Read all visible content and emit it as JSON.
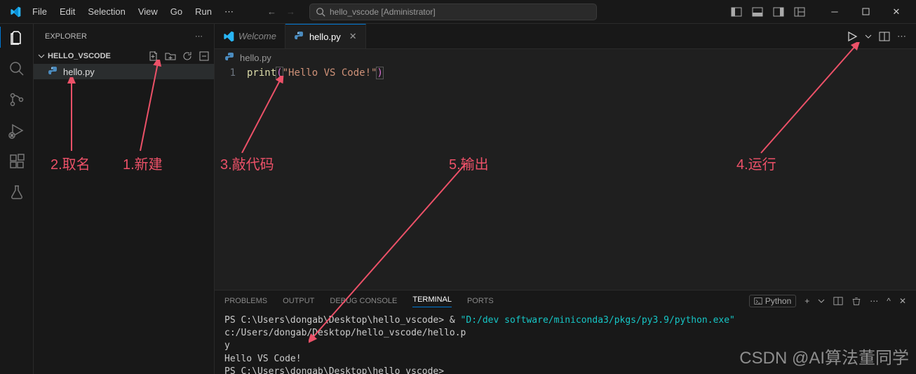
{
  "menu": [
    "File",
    "Edit",
    "Selection",
    "View",
    "Go",
    "Run"
  ],
  "search_placeholder": "hello_vscode [Administrator]",
  "sidebar": {
    "title": "EXPLORER",
    "folder": "HELLO_VSCODE",
    "file": "hello.py"
  },
  "tabs": {
    "welcome": "Welcome",
    "file": "hello.py"
  },
  "breadcrumb": "hello.py",
  "code": {
    "line_no": "1",
    "fn": "print",
    "lb": "(",
    "str": "\"Hello VS Code!\"",
    "rb": ")"
  },
  "panel": {
    "tabs": {
      "problems": "PROBLEMS",
      "output": "OUTPUT",
      "debug": "DEBUG CONSOLE",
      "terminal": "TERMINAL",
      "ports": "PORTS"
    },
    "shell": "Python"
  },
  "terminal": {
    "line1_prefix": "PS C:\\Users\\dongab\\Desktop\\hello_vscode> & ",
    "line1_cmd": "\"D:/dev software/miniconda3/pkgs/py3.9/python.exe\"",
    "line1_suffix": " c:/Users/dongab/Desktop/hello_vscode/hello.p",
    "line2": "y",
    "line3": "Hello VS Code!",
    "line4": "PS C:\\Users\\dongab\\Desktop\\hello_vscode>"
  },
  "annotations": {
    "a1": "1.新建",
    "a2": "2.取名",
    "a3": "3.敲代码",
    "a4": "4.运行",
    "a5": "5.输出"
  },
  "watermark": "CSDN @AI算法董同学"
}
